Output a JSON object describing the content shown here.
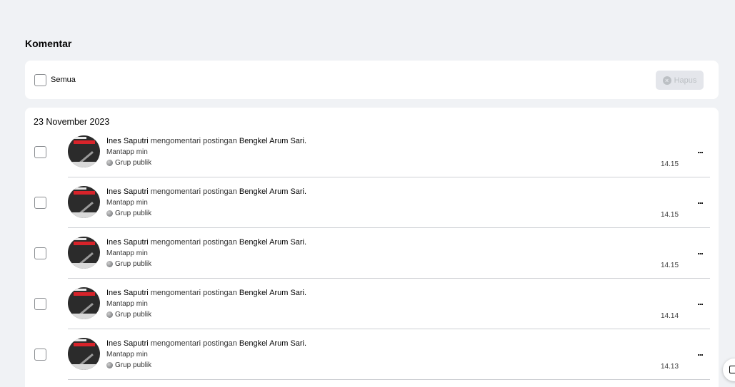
{
  "page": {
    "title": "Komentar"
  },
  "toolbar": {
    "select_all_label": "Semua",
    "delete_label": "Hapus",
    "delete_icon": "close-circle-icon"
  },
  "list": {
    "date": "23 November 2023",
    "items": [
      {
        "author": "Ines Saputri",
        "action": "mengomentari postingan",
        "target": "Bengkel Arum Sari.",
        "comment": "Mantapp min",
        "audience": "Grup publik",
        "time": "14.15"
      },
      {
        "author": "Ines Saputri",
        "action": "mengomentari postingan",
        "target": "Bengkel Arum Sari.",
        "comment": "Mantapp min",
        "audience": "Grup publik",
        "time": "14.15"
      },
      {
        "author": "Ines Saputri",
        "action": "mengomentari postingan",
        "target": "Bengkel Arum Sari.",
        "comment": "Mantapp min",
        "audience": "Grup publik",
        "time": "14.15"
      },
      {
        "author": "Ines Saputri",
        "action": "mengomentari postingan",
        "target": "Bengkel Arum Sari.",
        "comment": "Mantapp min",
        "audience": "Grup publik",
        "time": "14.14"
      },
      {
        "author": "Ines Saputri",
        "action": "mengomentari postingan",
        "target": "Bengkel Arum Sari.",
        "comment": "Mantapp min",
        "audience": "Grup publik",
        "time": "14.13"
      }
    ]
  },
  "colors": {
    "background": "#f0f2f5",
    "card": "#ffffff",
    "disabled_button": "#e4e6eb",
    "disabled_text": "#bcc0c4"
  }
}
